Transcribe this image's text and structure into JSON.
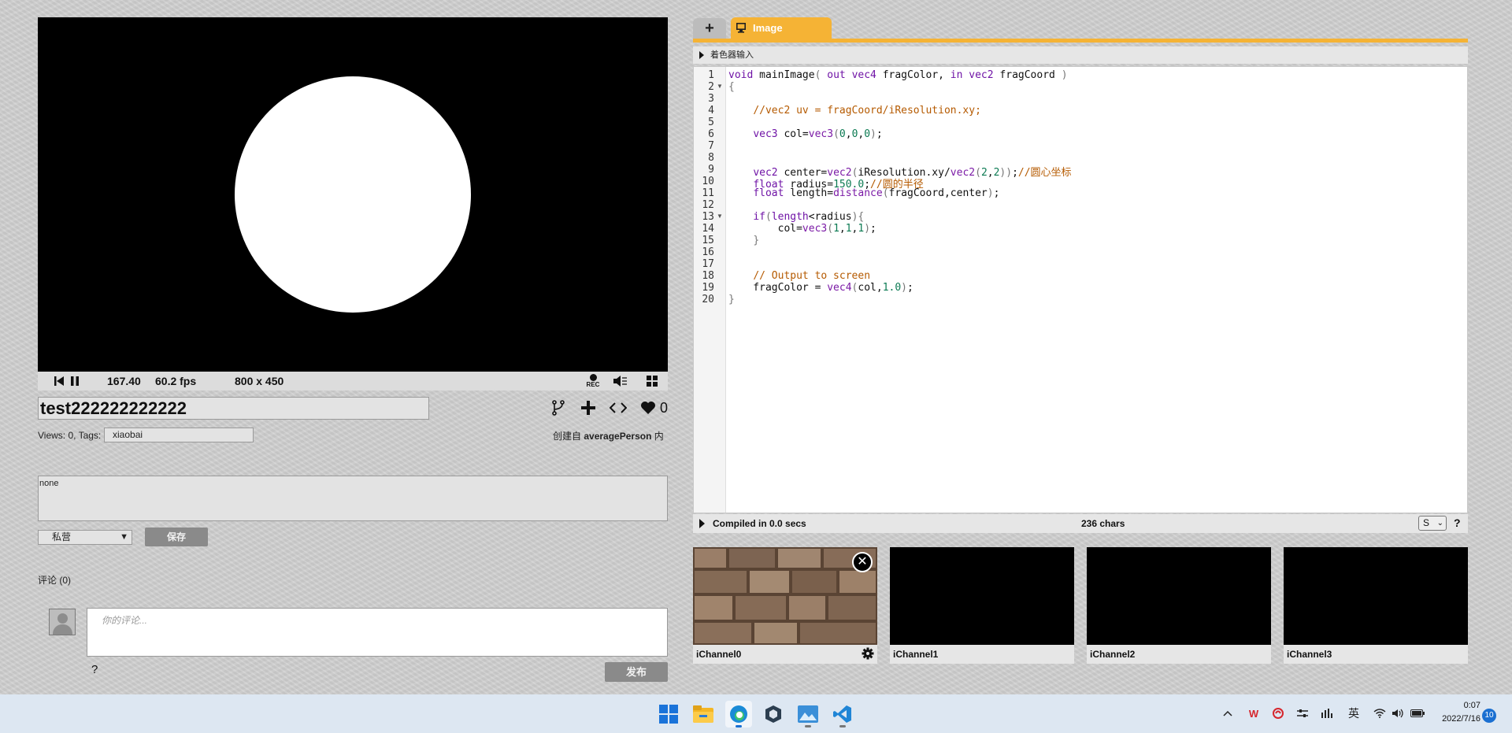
{
  "player": {
    "time": "167.40",
    "fps": "60.2 fps",
    "resolution": "800 x 450",
    "rec_label": "REC"
  },
  "shader": {
    "title": "test222222222222",
    "views_tags_label": "Views: 0, Tags:",
    "tags_value": "xiaobai",
    "created_prefix": "创建自",
    "author": "averagePerson",
    "created_suffix": "内",
    "likes": "0",
    "description": "none",
    "privacy": "私营",
    "save_label": "保存"
  },
  "comments": {
    "label": "评论 (0)",
    "placeholder": "你的评论...",
    "help": "?",
    "publish_label": "发布"
  },
  "editor": {
    "add_tab": "+",
    "tab_label": "Image",
    "shader_inputs_label": "着色器输入",
    "line_numbers": [
      "1",
      "2",
      "3",
      "4",
      "5",
      "6",
      "7",
      "8",
      "9",
      "10",
      "11",
      "12",
      "13",
      "14",
      "15",
      "16",
      "17",
      "18",
      "19",
      "20"
    ],
    "compiled_label": "Compiled in 0.0 secs",
    "chars_label": "236 chars",
    "mode_value": "S",
    "help": "?"
  },
  "channels": [
    {
      "label": "iChannel0",
      "texture": "stone-wall"
    },
    {
      "label": "iChannel1"
    },
    {
      "label": "iChannel2"
    },
    {
      "label": "iChannel3"
    }
  ],
  "taskbar": {
    "apps": [
      "windows-start-icon",
      "file-explorer-icon",
      "edge-browser-icon",
      "cube-app-icon",
      "photos-icon",
      "vscode-icon"
    ],
    "ime_label": "英",
    "time": "0:07",
    "date": "2022/7/16",
    "notifications": "10"
  },
  "colors": {
    "accent": "#f5b335",
    "keyword": "#6f13a6",
    "number": "#0b7a52",
    "comment": "#b55a00"
  }
}
